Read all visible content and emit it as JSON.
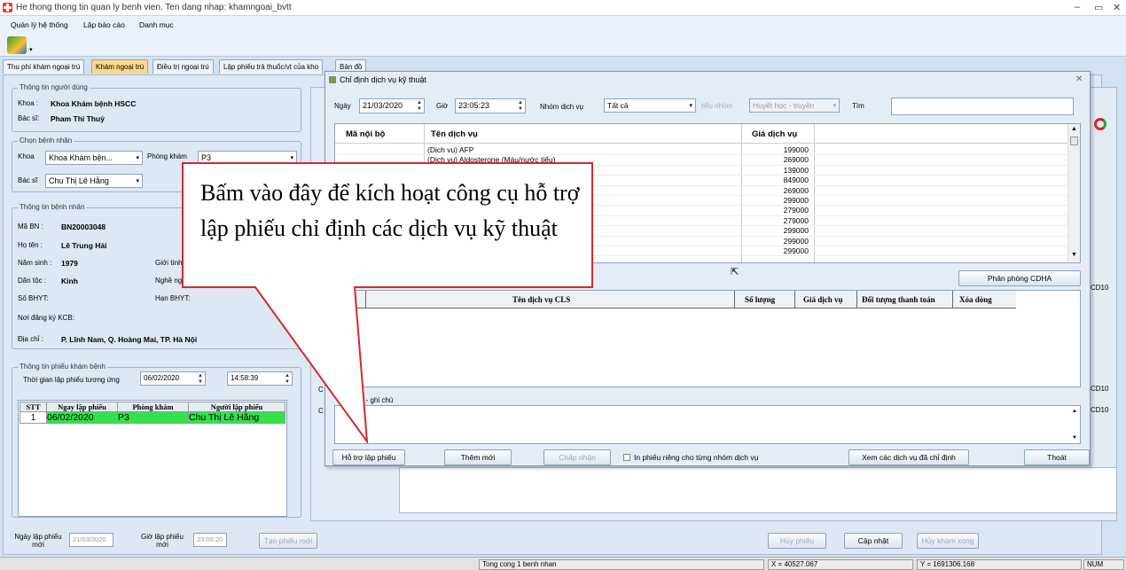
{
  "window": {
    "title": "He thong thong tin quan ly benh vien. Ten dang nhap: khamngoai_bvtt"
  },
  "menu": [
    "Quản lý hệ thống",
    "Lập báo cáo",
    "Danh mục"
  ],
  "tabs": [
    "Thu phí khám ngoại trú",
    "Khám ngoại trú",
    "Điều trị ngoại trú",
    "Lập phiếu trả thuốc/vt của kho",
    "Bản đồ"
  ],
  "user_info": {
    "legend": "Thông tin người dùng",
    "khoa_label": "Khoa :",
    "khoa_value": "Khoa Khám bệnh  HSCC",
    "bacsi_label": "Bác sĩ:",
    "bacsi_value": "Pham Thi Thuỷ"
  },
  "select_patient": {
    "legend": "Chọn bệnh nhân",
    "khoa_label": "Khoa",
    "khoa_value": "Khoa Khám bện...",
    "phong_label": "Phòng khám",
    "phong_value": "P3",
    "bacsi_label": "Bác sĩ",
    "bacsi_value": "Chu Thị Lê Hằng"
  },
  "patient": {
    "legend": "Thông tin bệnh nhân",
    "ma_label": "Mã BN :",
    "ma_value": "BN20003048",
    "ten_label": "Họ tên :",
    "ten_value": "Lê Trung Hải",
    "ns_label": "Năm sinh :",
    "ns_value": "1979",
    "gt_label": "Giới tính",
    "dt_label": "Dân tộc :",
    "dt_value": "Kinh",
    "nn_label": "Nghề ng",
    "bhyt_label": "Số BHYT:",
    "han_label": "Hạn BHYT:",
    "kcb_label": "Nơi đăng ký KCB:",
    "dc_label": "Địa chỉ :",
    "dc_value": "P. Lĩnh Nam, Q. Hoàng Mai, TP. Hà Nội"
  },
  "exam": {
    "legend": "Thông tin phiếu khám bệnh",
    "time_label": "Thời gian lập phiếu tương ứng",
    "date": "06/02/2020",
    "time": "14:58:39",
    "cols": [
      "STT",
      "Ngay lập phiếu",
      "Phòng khám",
      "Người lập phiếu"
    ],
    "rows": [
      [
        "1",
        "06/02/2020",
        "P3",
        "Chu Thị Lê Hằng"
      ]
    ]
  },
  "bottom_left": {
    "ngay_label": "Ngày lập phiếu mới",
    "ngay_value": "21/03/2020",
    "gio_label": "Giờ lập phiếu mới",
    "gio_value": "23:05:20",
    "new_btn": "Tạo phiếu mới"
  },
  "bottom_right": {
    "huy": "Hủy phiếu",
    "capnhat": "Cập nhật",
    "huykham": "Hủy khám xong"
  },
  "right_cd": [
    "CD10",
    "CD10",
    "CD10",
    "CD10"
  ],
  "dialog": {
    "title": "Chỉ định dịch vụ  kỹ thuật",
    "ngay_label": "Ngày",
    "ngay_value": "21/03/2020",
    "gio_label": "Giờ",
    "gio_value": "23:05:23",
    "nhom_label": "Nhóm dịch vụ",
    "nhom_value": "Tất cả",
    "tieu_label": "tiểu nhóm",
    "tieu_value": "Huyết học - truyền",
    "tim_label": "Tìm",
    "svc_cols": [
      "Mã nội bộ",
      "Tên dịch vụ",
      "Giá dịch vụ"
    ],
    "services": [
      {
        "ten": "(Dịch vụ) AFP",
        "gia": "199000"
      },
      {
        "ten": "(Dịch vụ) Aldosterone (Máu/nước tiểu)",
        "gia": "269000"
      },
      {
        "ten": "",
        "gia": "139000"
      },
      {
        "ten": "àn",
        "gia": "849000"
      },
      {
        "ten": "",
        "gia": "269000"
      },
      {
        "ten": "oàn toàn",
        "gia": "299000"
      },
      {
        "ten": "",
        "gia": "279000"
      },
      {
        "ten": "",
        "gia": "279000"
      },
      {
        "ten": "",
        "gia": "299000"
      },
      {
        "ten": "",
        "gia": "299000"
      },
      {
        "ten": "",
        "gia": "299000"
      }
    ],
    "phan_phong": "Phân phòng CDHA",
    "cls_cols": [
      "TT",
      "Tên dịch vụ CLS",
      "Số lượng",
      "Giá dịch vụ",
      "Đối tượng thanh toán",
      "Xóa dòng"
    ],
    "note_label": "dẫn - ghi chú",
    "c1": "C",
    "c2": "C",
    "btn_hotro": "Hỗ trợ lập phiếu",
    "btn_them": "Thêm mới",
    "btn_chapnhan": "Chấp nhận",
    "chk_label": "In phiếu riêng cho từng nhóm dịch vụ",
    "btn_xem": "Xem các dịch vụ đã chỉ định",
    "btn_thoat": "Thoát"
  },
  "callout": "Bấm vào đây để kích hoạt công cụ hỗ trợ lập phiếu chỉ định các dịch vụ kỹ thuật",
  "status": {
    "a": "Tong cong 1 benh nhan",
    "x": "X = 40527.067",
    "y": "Y = 1691306.168",
    "num": "NUM"
  }
}
